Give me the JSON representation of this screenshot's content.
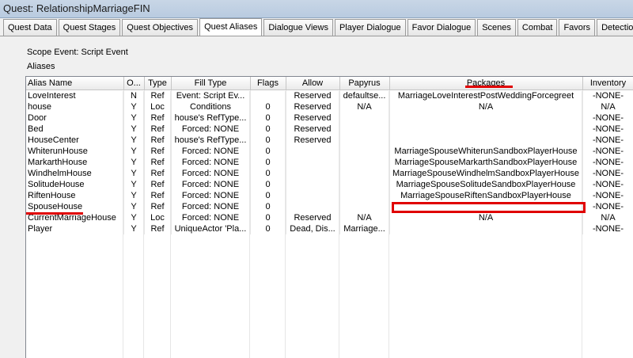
{
  "window": {
    "title": "Quest: RelationshipMarriageFIN"
  },
  "tabs": [
    {
      "label": "Quest Data"
    },
    {
      "label": "Quest Stages"
    },
    {
      "label": "Quest Objectives"
    },
    {
      "label": "Quest Aliases",
      "active": true
    },
    {
      "label": "Dialogue Views"
    },
    {
      "label": "Player Dialogue"
    },
    {
      "label": "Favor Dialogue"
    },
    {
      "label": "Scenes"
    },
    {
      "label": "Combat"
    },
    {
      "label": "Favors"
    },
    {
      "label": "Detection"
    }
  ],
  "panel": {
    "scope_event": "Scope Event: Script Event",
    "aliases_label": "Aliases"
  },
  "table": {
    "columns": [
      "Alias Name",
      "O...",
      "Type",
      "Fill Type",
      "Flags",
      "Allow",
      "Papyrus",
      "Packages",
      "Inventory"
    ],
    "rows": [
      [
        "LoveInterest",
        "N",
        "Ref",
        "Event: Script Ev...",
        "",
        "Reserved",
        "defaultse...",
        "MarriageLoveInterestPostWeddingForcegreet",
        "-NONE-"
      ],
      [
        "house",
        "Y",
        "Loc",
        "Conditions",
        "0",
        "Reserved",
        "N/A",
        "N/A",
        "N/A"
      ],
      [
        "Door",
        "Y",
        "Ref",
        "house's RefType...",
        "0",
        "Reserved",
        "",
        "",
        "-NONE-"
      ],
      [
        "Bed",
        "Y",
        "Ref",
        "Forced: NONE",
        "0",
        "Reserved",
        "",
        "",
        "-NONE-"
      ],
      [
        "HouseCenter",
        "Y",
        "Ref",
        "house's RefType...",
        "0",
        "Reserved",
        "",
        "",
        "-NONE-"
      ],
      [
        "WhiterunHouse",
        "Y",
        "Ref",
        "Forced: NONE",
        "0",
        "",
        "",
        "MarriageSpouseWhiterunSandboxPlayerHouse",
        "-NONE-"
      ],
      [
        "MarkarthHouse",
        "Y",
        "Ref",
        "Forced: NONE",
        "0",
        "",
        "",
        "MarriageSpouseMarkarthSandboxPlayerHouse",
        "-NONE-"
      ],
      [
        "WindhelmHouse",
        "Y",
        "Ref",
        "Forced: NONE",
        "0",
        "",
        "",
        "MarriageSpouseWindhelmSandboxPlayerHouse",
        "-NONE-"
      ],
      [
        "SolitudeHouse",
        "Y",
        "Ref",
        "Forced: NONE",
        "0",
        "",
        "",
        "MarriageSpouseSolitudeSandboxPlayerHouse",
        "-NONE-"
      ],
      [
        "RiftenHouse",
        "Y",
        "Ref",
        "Forced: NONE",
        "0",
        "",
        "",
        "MarriageSpouseRiftenSandboxPlayerHouse",
        "-NONE-"
      ],
      [
        "SpouseHouse",
        "Y",
        "Ref",
        "Forced: NONE",
        "0",
        "",
        "",
        "",
        "-NONE-"
      ],
      [
        "CurrentMarriageHouse",
        "Y",
        "Loc",
        "Forced: NONE",
        "0",
        "Reserved",
        "N/A",
        "N/A",
        "N/A"
      ],
      [
        "Player",
        "Y",
        "Ref",
        "UniqueActor 'Pla...",
        "0",
        "Dead, Dis...",
        "Marriage...",
        "",
        "-NONE-"
      ]
    ]
  },
  "annotations": {
    "highlight_color": "#e00000"
  }
}
